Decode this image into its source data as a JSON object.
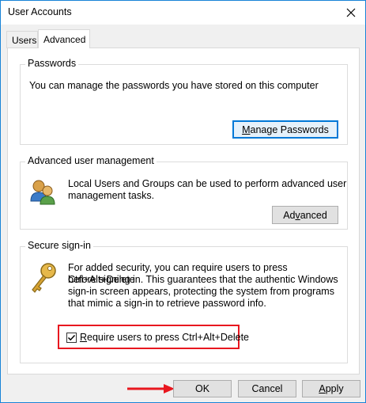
{
  "window": {
    "title": "User Accounts"
  },
  "tabs": [
    {
      "label": "Users"
    },
    {
      "label": "Advanced"
    }
  ],
  "passwords": {
    "title": "Passwords",
    "description": "You can manage the passwords you have stored on this computer",
    "button_pre": "",
    "button_ul": "M",
    "button_post": "anage Passwords"
  },
  "user_mgmt": {
    "title": "Advanced user management",
    "description_line1": "Local Users and Groups can be used to perform advanced user",
    "description_line2": "management tasks.",
    "button_pre": "Ad",
    "button_ul": "v",
    "button_post": "anced"
  },
  "secure_signin": {
    "title": "Secure sign-in",
    "lines": [
      "For added security, you can require users to press Ctrl+Alt+Delete",
      "before signing in. This guarantees that the authentic Windows",
      "sign-in screen appears, protecting the system from programs",
      "that mimic a sign-in to retrieve password info."
    ],
    "checkbox_label_pre": "",
    "checkbox_label_ul": "R",
    "checkbox_label_post": "equire users to press Ctrl+Alt+Delete",
    "checked": true
  },
  "footer": {
    "ok": "OK",
    "cancel": "Cancel",
    "apply_ul": "A",
    "apply_post": "pply"
  },
  "colors": {
    "accent": "#0078d7",
    "highlight_red": "#e8171f"
  }
}
